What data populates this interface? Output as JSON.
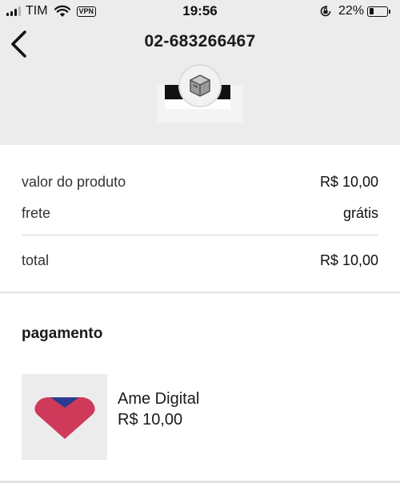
{
  "status_bar": {
    "carrier": "TIM",
    "vpn_badge": "VPN",
    "time": "19:56",
    "battery_percent": "22%",
    "battery_level": 0.22
  },
  "header": {
    "title": "02-683266467",
    "back_icon": "chevron-left-icon",
    "product_icon": "package-box-icon"
  },
  "summary": {
    "product_value_label": "valor do produto",
    "product_value": "R$ 10,00",
    "shipping_label": "frete",
    "shipping_value": "grátis",
    "total_label": "total",
    "total_value": "R$ 10,00"
  },
  "payment": {
    "section_title": "pagamento",
    "method_name": "Ame Digital",
    "method_amount": "R$ 10,00",
    "logo_icon": "ame-digital-heart-icon",
    "logo_colors": {
      "heart": "#cf3a5b",
      "accent": "#2c3b8f"
    }
  }
}
